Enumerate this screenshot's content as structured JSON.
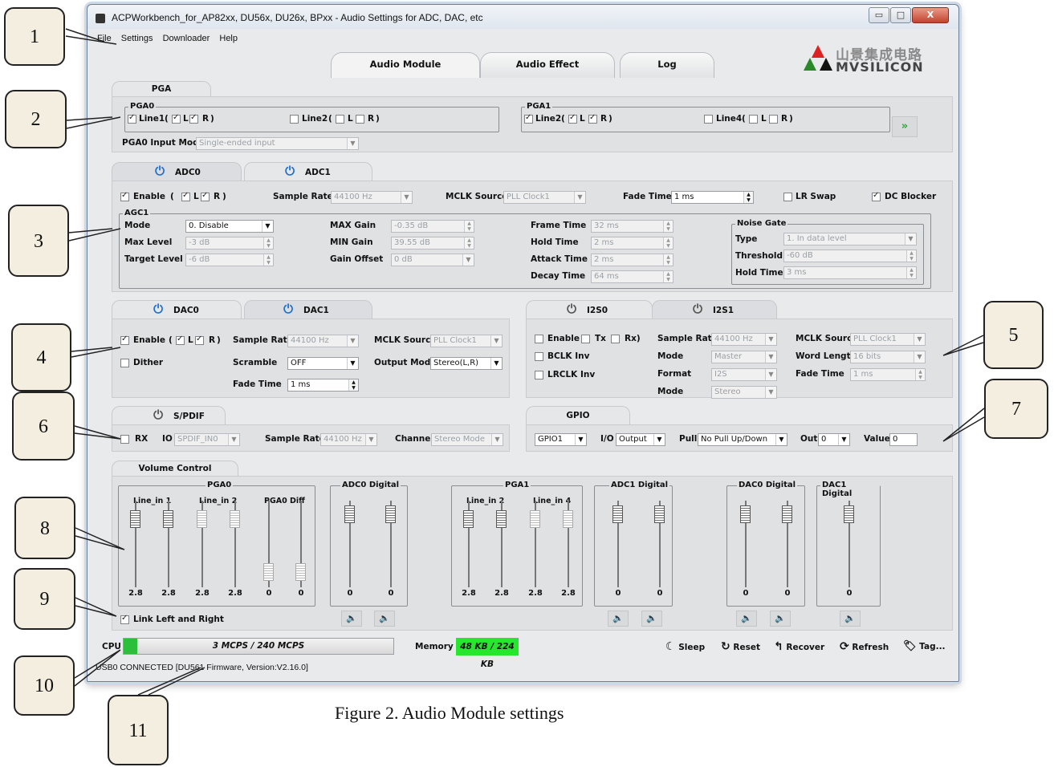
{
  "window": {
    "title": "ACPWorkbench_for_AP82xx, DU56x, DU26x, BPxx - Audio Settings for ADC, DAC, etc",
    "min": "▭",
    "max": "□",
    "close": "X"
  },
  "menu": [
    "File",
    "Settings",
    "Downloader",
    "Help"
  ],
  "logo": {
    "cn": "山景集成电路",
    "en": "MVSILICON"
  },
  "tabs": [
    "Audio Module",
    "Audio Effect",
    "Log"
  ],
  "pga": {
    "tab": "PGA",
    "pga0": {
      "title": "PGA0",
      "line1": "Line1",
      "paren_open": "(",
      "l": "L",
      "r": "R",
      "paren_close": ")",
      "line2": "Line2"
    },
    "pga1": {
      "title": "PGA1",
      "line2": "Line2",
      "line4": "Line4"
    },
    "input_mode_label": "PGA0 Input Mode",
    "input_mode_value": "Single-ended input",
    "next_label": "»"
  },
  "adc": {
    "tabs": [
      "ADC0",
      "ADC1"
    ],
    "enable": "Enable",
    "sample_rate_label": "Sample Rate",
    "sample_rate": "44100 Hz",
    "mclk_label": "MCLK Source",
    "mclk": "PLL Clock1",
    "fade_label": "Fade Time",
    "fade": "1 ms",
    "lr_swap": "LR Swap",
    "dc_blocker": "DC Blocker",
    "agc": {
      "title": "AGC1",
      "mode_label": "Mode",
      "mode": "0. Disable",
      "max_level_label": "Max Level",
      "max_level": "-3 dB",
      "target_level_label": "Target Level",
      "target_level": "-6 dB",
      "max_gain_label": "MAX Gain",
      "max_gain": "-0.35 dB",
      "min_gain_label": "MIN Gain",
      "min_gain": "39.55 dB",
      "gain_offset_label": "Gain Offset",
      "gain_offset": "0 dB",
      "frame_time_label": "Frame Time",
      "frame_time": "32 ms",
      "hold_time_label": "Hold   Time",
      "hold_time": "2 ms",
      "attack_time_label": "Attack Time",
      "attack_time": "2 ms",
      "decay_time_label": "Decay Time",
      "decay_time": "64 ms"
    },
    "noise_gate": {
      "title": "Noise Gate",
      "type_label": "Type",
      "type": "1. In data level",
      "threshold_label": "Threshold",
      "threshold": "-60 dB",
      "hold_label": "Hold Time",
      "hold": "3 ms"
    }
  },
  "dac": {
    "tabs": [
      "DAC0",
      "DAC1"
    ],
    "enable": "Enable",
    "dither": "Dither",
    "sample_rate_label": "Sample Rate",
    "sample_rate": "44100 Hz",
    "scramble_label": "Scramble",
    "scramble": "OFF",
    "fade_label": "Fade Time",
    "fade": "1 ms",
    "mclk_label": "MCLK Source",
    "mclk": "PLL Clock1",
    "output_label": "Output Mode",
    "output": "Stereo(L,R)"
  },
  "i2s": {
    "tabs": [
      "I2S0",
      "I2S1"
    ],
    "enable": "Enable (",
    "tx": "Tx",
    "rx": "Rx)",
    "bclk": "BCLK Inv",
    "lrclk": "LRCLK Inv",
    "sample_rate_label": "Sample Rate",
    "sample_rate": "44100 Hz",
    "mode_label": "Mode",
    "mode": "Master",
    "format_label": "Format",
    "format": "I2S",
    "mode2_label": "Mode",
    "mode2": "Stereo",
    "mclk_label": "MCLK Source",
    "mclk": "PLL Clock1",
    "word_label": "Word Length",
    "word": "16 bits",
    "fade_label": "Fade Time",
    "fade": "1 ms"
  },
  "spdif": {
    "tab": "S/PDIF",
    "rx": "RX",
    "io_label": "IO",
    "io": "SPDIF_IN0",
    "sample_rate_label": "Sample Rate",
    "sample_rate": "44100 Hz",
    "channel_label": "Channel",
    "channel": "Stereo Mode"
  },
  "gpio": {
    "tab": "GPIO",
    "gpio": "GPIO1",
    "io_label": "I/O",
    "io": "Output",
    "pull_label": "Pull",
    "pull": "No Pull Up/Down",
    "out_label": "Out",
    "out": "0",
    "value_label": "Value",
    "value": "0"
  },
  "volume": {
    "tab": "Volume Control",
    "groups": {
      "pga0": "PGA0",
      "adc0": "ADC0 Digital",
      "pga1": "PGA1",
      "adc1": "ADC1 Digital",
      "dac0": "DAC0 Digital",
      "dac1": "DAC1 Digital"
    },
    "sub": {
      "line_in1": "Line_in 1",
      "line_in2": "Line_in 2",
      "pga0diff": "PGA0 Diff",
      "pga1_line2": "Line_in 2",
      "pga1_line4": "Line_in 4"
    },
    "values": {
      "pga0": [
        "2.8",
        "2.8",
        "2.8",
        "2.8",
        "0",
        "0"
      ],
      "adc0": [
        "0",
        "0"
      ],
      "pga1": [
        "2.8",
        "2.8",
        "2.8",
        "2.8"
      ],
      "adc1": [
        "0",
        "0"
      ],
      "dac0": [
        "0",
        "0"
      ],
      "dac1": [
        "0"
      ]
    },
    "link": "Link Left and Right"
  },
  "status": {
    "cpu_label": "CPU",
    "cpu_value": "3 MCPS / 240 MCPS",
    "cpu_fraction": 0.0125,
    "mem_label": "Memory",
    "mem_value": "48 KB / 224 KB",
    "connection": "USB0 CONNECTED [DU561 Firmware, Version:V2.16.0]"
  },
  "actions": {
    "sleep": "Sleep",
    "reset": "Reset",
    "recover": "Recover",
    "refresh": "Refresh",
    "tag": "Tag..."
  },
  "callouts": [
    "1",
    "2",
    "3",
    "4",
    "5",
    "6",
    "7",
    "8",
    "9",
    "10",
    "11"
  ],
  "caption": "Figure 2. Audio Module settings",
  "colors": {
    "power_on": "#1f6fd1",
    "mem_bg": "#27e62d",
    "next_green": "#2ea836"
  }
}
